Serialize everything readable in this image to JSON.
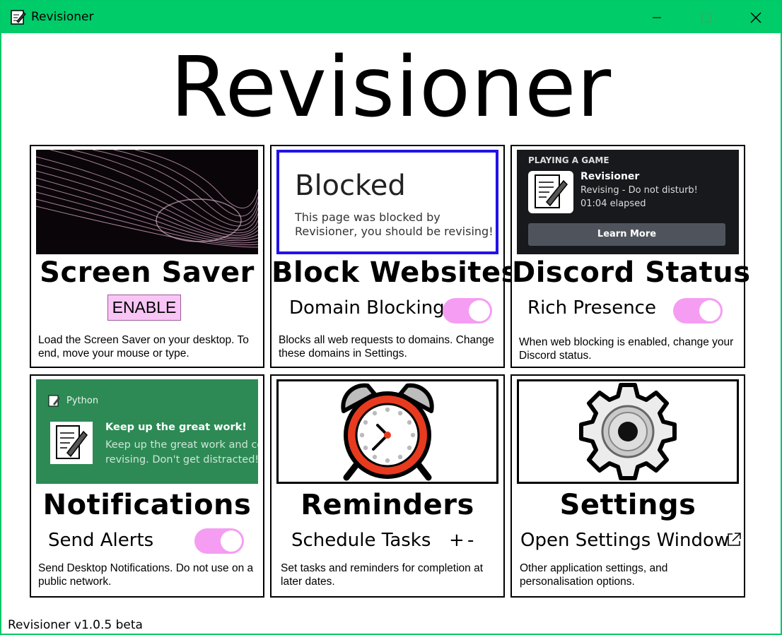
{
  "window": {
    "title": "Revisioner",
    "accent": "#00cc6a"
  },
  "app_title": "Revisioner",
  "cards": {
    "screen_saver": {
      "heading": "Screen Saver",
      "button_label": "ENABLE",
      "description": "Load the Screen Saver on your desktop. To end, move your mouse or type."
    },
    "block_websites": {
      "heading": "Block Websites",
      "preview_title": "Blocked",
      "preview_text": "This page was blocked by Revisioner, you should be revising!",
      "option_label": "Domain Blocking",
      "toggle_on": true,
      "description": "Blocks all web requests to domains. Change these domains in Settings."
    },
    "discord_status": {
      "heading": "Discord Status",
      "preview_header": "PLAYING A GAME",
      "preview_game": "Revisioner",
      "preview_detail": "Revising - Do not disturb!",
      "preview_elapsed": "01:04 elapsed",
      "preview_button": "Learn More",
      "option_label": "Rich Presence",
      "toggle_on": true,
      "description": "When web blocking is enabled, change your Discord status."
    },
    "notifications": {
      "heading": "Notifications",
      "preview_source": "Python",
      "preview_title": "Keep up the great work!",
      "preview_body_1": "Keep up the great work and co",
      "preview_body_2": "revising. Don't get distracted!",
      "option_label": "Send Alerts",
      "toggle_on": true,
      "description": "Send Desktop Notifications. Do not use on a public network."
    },
    "reminders": {
      "heading": "Reminders",
      "option_label": "Schedule Tasks",
      "add_label": "+",
      "remove_label": "-",
      "description": "Set tasks and reminders for completion at later dates."
    },
    "settings": {
      "heading": "Settings",
      "option_label": "Open Settings Window",
      "description": "Other application settings, and personalisation options."
    }
  },
  "icons": {
    "app": "notepad-pencil-icon",
    "minimize": "minimize-icon",
    "maximize": "maximize-icon",
    "close": "close-icon",
    "clock": "alarm-clock-icon",
    "gear": "gear-icon",
    "external": "external-link-icon"
  },
  "colors": {
    "toggle": "#f59df2",
    "enable_button": "#f9c5f5",
    "blocked_border": "#2212e8",
    "notification_bg": "#2d8a55",
    "discord_bg": "#18191c"
  },
  "footer": {
    "version": "Revisioner v1.0.5 beta"
  }
}
